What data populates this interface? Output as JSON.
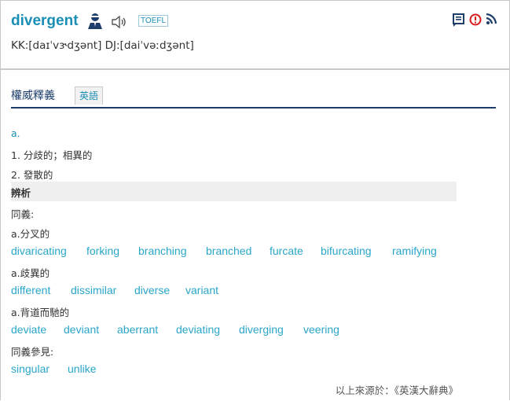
{
  "entry": {
    "word": "divergent",
    "tag": "TOEFL",
    "phonetics": "KK:[daɪˈvɝdʒənt] DJ:[daiˈvəːdʒənt]"
  },
  "tabs": {
    "main": "權威釋義",
    "sub": "英語"
  },
  "definitions": {
    "pos": "a.",
    "items": [
      "1. 分歧的；相異的",
      "2. 發散的"
    ]
  },
  "analysis": {
    "heading": "辨析",
    "synonyms_label": "同義:",
    "groups": [
      {
        "label": "a.分叉的",
        "words": [
          "divaricating",
          "forking",
          "branching",
          "branched",
          "furcate",
          "bifurcating",
          "ramifying"
        ]
      },
      {
        "label": "a.歧異的",
        "words": [
          "different",
          "dissimilar",
          "diverse",
          "variant"
        ]
      },
      {
        "label": "a.背道而馳的",
        "words": [
          "deviate",
          "deviant",
          "aberrant",
          "deviating",
          "diverging",
          "veering"
        ]
      }
    ],
    "see_also_label": "同義參見:",
    "see_also": [
      "singular",
      "unlike"
    ]
  },
  "source": "以上來源於：《英漢大辭典》",
  "colors": {
    "link": "#2aa6c8",
    "title": "#1a8fb5",
    "rule": "#1d3d6b",
    "alert": "#d71a1a"
  },
  "icons": [
    "user-icon",
    "speaker-icon",
    "bookmark-icon",
    "alert-icon",
    "rss-icon"
  ]
}
